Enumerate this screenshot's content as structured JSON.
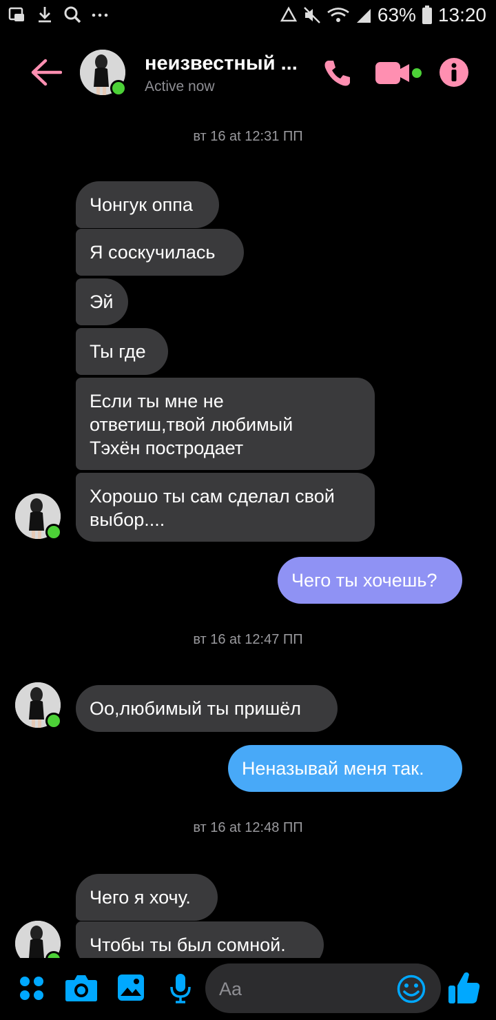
{
  "status_bar": {
    "left_icons": [
      "screenshot-icon",
      "download-icon",
      "search-icon",
      "more-icon"
    ],
    "battery": "63%",
    "time": "13:20"
  },
  "header": {
    "contact_name": "неизвестный ...",
    "status": "Active now",
    "accent": "#ff8fb1"
  },
  "messages": [
    {
      "type": "timestamp",
      "text": "вт 16 at 12:31 ПП"
    },
    {
      "type": "in",
      "text": "Чонгук оппа"
    },
    {
      "type": "in",
      "text": "Я соскучилась"
    },
    {
      "type": "in",
      "text": "Эй"
    },
    {
      "type": "in",
      "text": "Ты где"
    },
    {
      "type": "in",
      "text": "Если ты мне не\nответиш,твой любимый\nТэхён постродает"
    },
    {
      "type": "in",
      "text": "Хорошо ты сам сделал свой\nвыбор...."
    },
    {
      "type": "out",
      "text": "Чего ты хочешь?",
      "color": "#8f92f4"
    },
    {
      "type": "timestamp",
      "text": "вт 16 at 12:47 ПП"
    },
    {
      "type": "in",
      "text": "Оо,любимый ты пришёл"
    },
    {
      "type": "out",
      "text": "Неназывай меня так.",
      "color": "#48a9f8"
    },
    {
      "type": "timestamp",
      "text": "вт 16 at 12:48 ПП"
    },
    {
      "type": "in",
      "text": "Чего я хочу."
    },
    {
      "type": "in",
      "text": "Чтобы ты был сомной."
    }
  ],
  "composer": {
    "placeholder": "Aa",
    "icons": [
      "apps-icon",
      "camera-icon",
      "gallery-icon",
      "microphone-icon",
      "emoji-icon",
      "thumbs-up-icon"
    ],
    "accent": "#00a8ff"
  }
}
